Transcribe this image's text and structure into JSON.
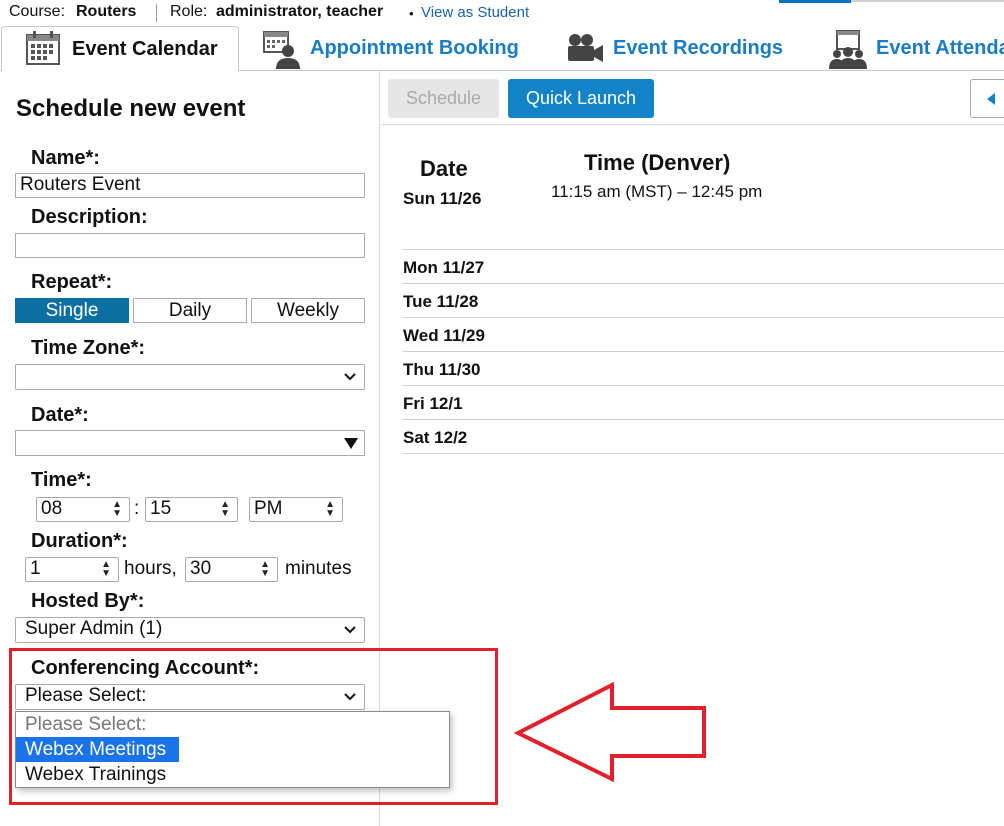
{
  "header": {
    "course_label": "Course:",
    "course_name": "Routers",
    "role_label": "Role:",
    "role_value": "administrator, teacher",
    "bullet": "•",
    "view_as_link": "View as Student"
  },
  "tabs": [
    {
      "label": "Event Calendar",
      "icon": "calendar-icon",
      "active": true
    },
    {
      "label": "Appointment Booking",
      "icon": "person-calendar-icon",
      "active": false
    },
    {
      "label": "Event Recordings",
      "icon": "video-camera-icon",
      "active": false
    },
    {
      "label": "Event Attenda",
      "icon": "attendees-icon",
      "active": false
    }
  ],
  "form": {
    "title": "Schedule new event",
    "name_label": "Name*:",
    "name_value": "Routers Event",
    "description_label": "Description:",
    "description_value": "",
    "repeat_label": "Repeat*:",
    "repeat_options": [
      "Single",
      "Daily",
      "Weekly"
    ],
    "repeat_selected": "Single",
    "timezone_label": "Time Zone*:",
    "timezone_value": "",
    "date_label": "Date*:",
    "date_value": "",
    "time_label": "Time*:",
    "time_hour": "08",
    "time_sep": ":",
    "time_minute": "15",
    "time_ampm": "PM",
    "duration_label": "Duration*:",
    "duration_hours": "1",
    "hours_text": "hours,",
    "duration_minutes": "30",
    "minutes_text": "minutes",
    "hosted_label": "Hosted By*:",
    "hosted_value": "Super Admin (1)",
    "conf_label": "Conferencing Account*:",
    "conf_value": "Please Select:",
    "conf_options": [
      "Please Select:",
      "Webex Meetings",
      "Webex Trainings"
    ],
    "conf_highlighted": "Webex Meetings"
  },
  "toolbar": {
    "schedule_label": "Schedule",
    "quick_launch_label": "Quick Launch"
  },
  "schedule_table": {
    "date_header": "Date",
    "time_header": "Time (Denver)",
    "first_time": "11:15 am (MST) – 12:45 pm",
    "dates": [
      "Sun 11/26",
      "Mon 11/27",
      "Tue 11/28",
      "Wed 11/29",
      "Thu 11/30",
      "Fri 12/1",
      "Sat 12/2"
    ]
  },
  "colors": {
    "accent": "#1283c7",
    "tab_text": "#1a7cc1",
    "segment_active": "#0b6fa1",
    "option_highlight": "#1a73e8",
    "annotation_red": "#e0202a"
  }
}
